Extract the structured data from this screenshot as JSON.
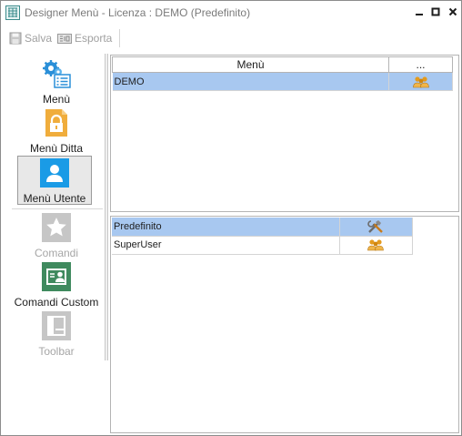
{
  "window": {
    "title": "Designer Menù - Licenza : DEMO (Predefinito)",
    "icon": "grid-app-icon",
    "controls": [
      "minimize",
      "maximize",
      "close"
    ]
  },
  "toolbar": {
    "save_label": "Salva",
    "export_label": "Esporta"
  },
  "nav": {
    "items": [
      {
        "label": "Menù",
        "icon": "gears-list-icon",
        "enabled": true,
        "selected": false
      },
      {
        "label": "Menù Ditta",
        "icon": "lock-document-icon",
        "enabled": true,
        "selected": false
      },
      {
        "label": "Menù Utente",
        "icon": "user-icon",
        "enabled": true,
        "selected": true
      },
      {
        "label": "Comandi",
        "icon": "star-icon",
        "enabled": false,
        "selected": false
      },
      {
        "label": "Comandi Custom",
        "icon": "user-card-icon",
        "enabled": true,
        "selected": false
      },
      {
        "label": "Toolbar",
        "icon": "toolbar-icon",
        "enabled": false,
        "selected": false
      }
    ]
  },
  "menu_grid": {
    "columns": [
      "Menù",
      "..."
    ],
    "rows": [
      {
        "name": "DEMO",
        "icon": "users-group-icon",
        "selected": true
      }
    ]
  },
  "users_grid": {
    "rows": [
      {
        "name": "Predefinito",
        "icon": "tools-icon",
        "selected": true
      },
      {
        "name": "SuperUser",
        "icon": "users-group-icon",
        "selected": false
      }
    ]
  },
  "colors": {
    "selection": "#a8c8f0",
    "accent_blue": "#1a9be6",
    "accent_orange": "#f0ad3c",
    "accent_green": "#3f8a5e",
    "disabled_gray": "#b8b8b8"
  }
}
